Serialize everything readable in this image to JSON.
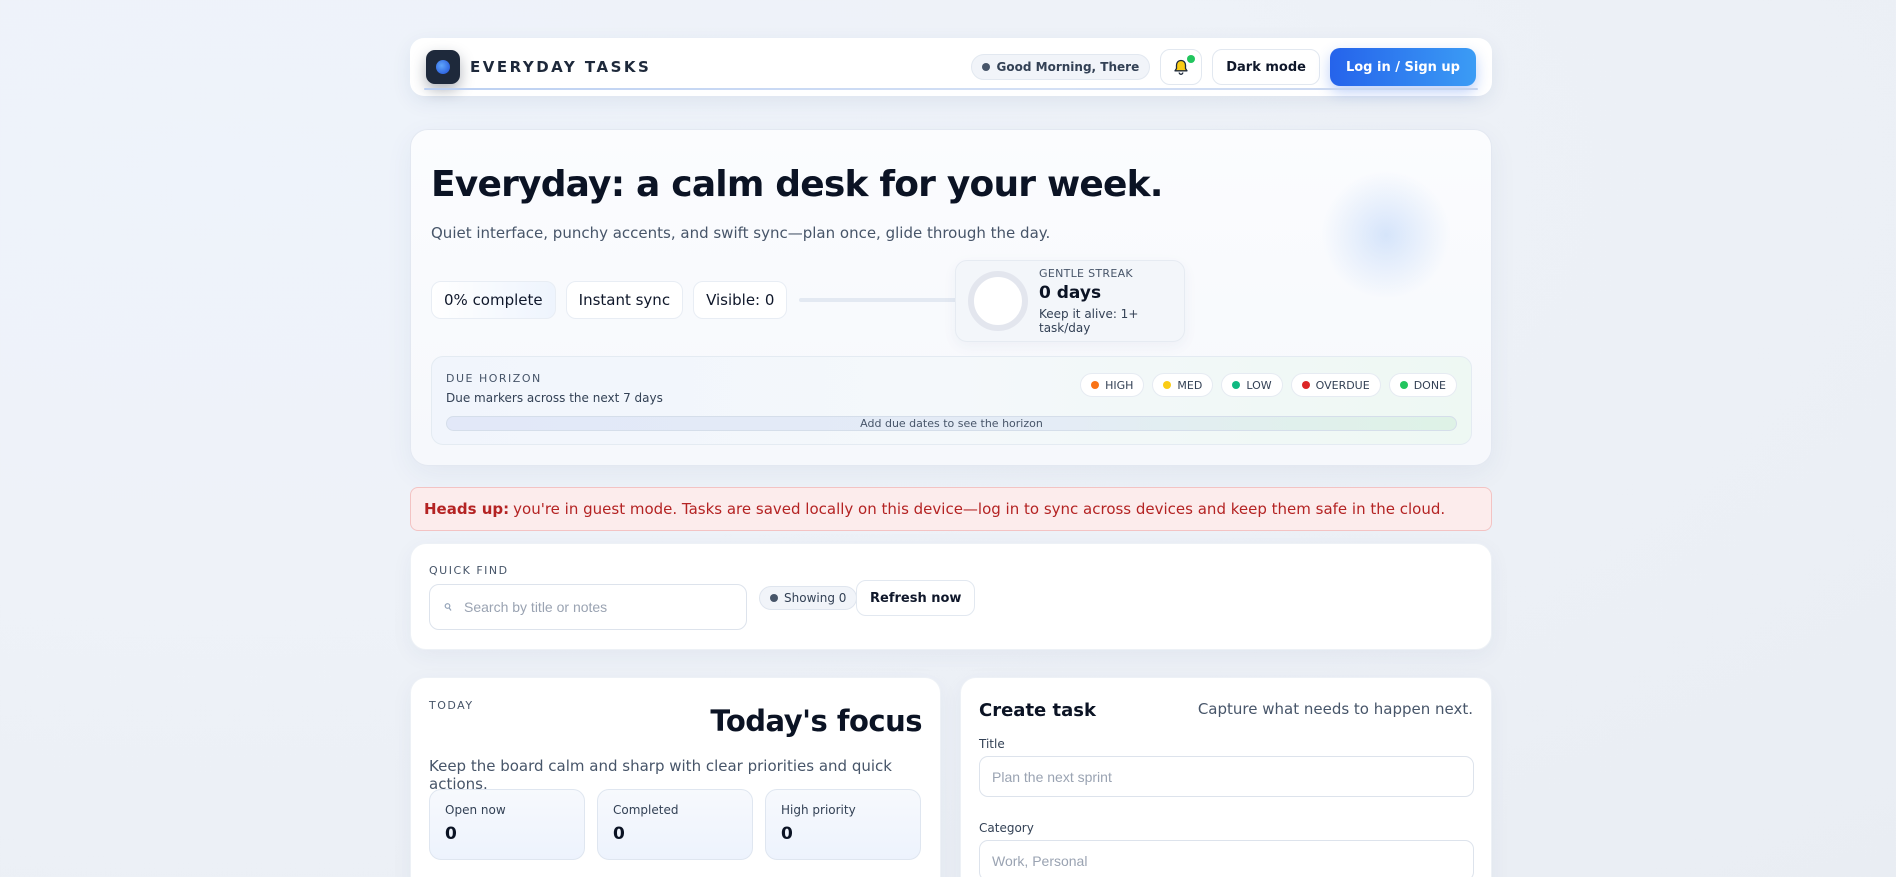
{
  "header": {
    "brand": "EVERYDAY TASKS",
    "greeting": "Good Morning, There",
    "dark_mode_label": "Dark mode",
    "login_label": "Log in / Sign up"
  },
  "hero": {
    "title": "Everyday: a calm desk for your week.",
    "subtitle": "Quiet interface, punchy accents, and swift sync—plan once, glide through the day.",
    "chips": [
      "0% complete",
      "Instant sync",
      "Visible: 0"
    ],
    "progress": 0,
    "streak": {
      "label": "GENTLE STREAK",
      "value": "0 days",
      "hint": "Keep it alive: 1+ task/day"
    },
    "horizon": {
      "label": "DUE HORIZON",
      "subtitle": "Due markers across the next 7 days",
      "empty": "Add due dates to see the horizon",
      "legend": [
        {
          "label": "HIGH",
          "color": "#f97316"
        },
        {
          "label": "MED",
          "color": "#facc15"
        },
        {
          "label": "LOW",
          "color": "#10b981"
        },
        {
          "label": "OVERDUE",
          "color": "#dc2626"
        },
        {
          "label": "DONE",
          "color": "#22c55e"
        }
      ]
    }
  },
  "alert": {
    "strong": "Heads up:",
    "text": "you're in guest mode. Tasks are saved locally on this device—log in to sync across devices and keep them safe in the cloud."
  },
  "quick_find": {
    "label": "QUICK FIND",
    "placeholder": "Search by title or notes",
    "showing": "Showing 0",
    "refresh_label": "Refresh now"
  },
  "today": {
    "label": "TODAY",
    "title": "Today's focus",
    "subtitle": "Keep the board calm and sharp with clear priorities and quick actions.",
    "stats": [
      {
        "label": "Open now",
        "value": "0"
      },
      {
        "label": "Completed",
        "value": "0"
      },
      {
        "label": "High priority",
        "value": "0"
      }
    ]
  },
  "create": {
    "title": "Create task",
    "subtitle": "Capture what needs to happen next.",
    "title_label": "Title",
    "title_placeholder": "Plan the next sprint",
    "category_label": "Category",
    "category_placeholder": "Work, Personal"
  },
  "colors": {
    "accent": "#2563eb",
    "alert_text": "#b42323",
    "alert_bg": "#fcecec",
    "notification": "#22c55e"
  }
}
